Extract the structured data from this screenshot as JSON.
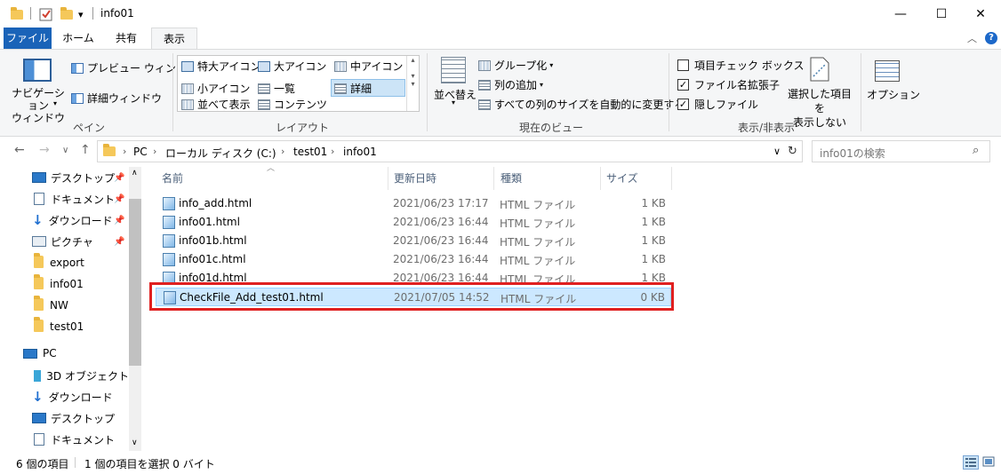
{
  "window": {
    "title": "info01",
    "minimize": "—",
    "maximize": "☐",
    "close": "✕"
  },
  "quick_access": {
    "properties_icon": "checkbox-icon",
    "dropdown": "▾"
  },
  "tabs": [
    "ファイル",
    "ホーム",
    "共有",
    "表示"
  ],
  "ribbon": {
    "pane": {
      "nav_pane": "ナビゲーション\nウィンドウ",
      "preview": "プレビュー ウィンドウ",
      "details": "詳細ウィンドウ",
      "label": "ペイン"
    },
    "layout": {
      "items": [
        "特大アイコン",
        "大アイコン",
        "中アイコン",
        "小アイコン",
        "一覧",
        "詳細",
        "並べて表示",
        "コンテンツ"
      ],
      "selected": "詳細",
      "label": "レイアウト"
    },
    "current_view": {
      "sort": "並べ替え",
      "group": "グループ化",
      "add_column": "列の追加",
      "autosize": "すべての列のサイズを自動的に変更する",
      "label": "現在のビュー"
    },
    "show_hide": {
      "item_checkbox": "項目チェック ボックス",
      "extensions": "ファイル名拡張子",
      "hidden": "隠しファイル",
      "hide_selected": "選択した項目を\n表示しない",
      "label": "表示/非表示",
      "checked": {
        "item_checkbox": false,
        "extensions": true,
        "hidden": true
      }
    },
    "options": "オプション"
  },
  "address": {
    "crumbs": [
      "PC",
      "ローカル ディスク (C:)",
      "test01",
      "info01"
    ],
    "search_placeholder": "info01の検索"
  },
  "nav_pane": {
    "items": [
      {
        "label": "デスクトップ",
        "icon": "desktop-icon",
        "pinned": true
      },
      {
        "label": "ドキュメント",
        "icon": "document-icon",
        "pinned": true
      },
      {
        "label": "ダウンロード",
        "icon": "download-icon",
        "pinned": true
      },
      {
        "label": "ピクチャ",
        "icon": "pictures-icon",
        "pinned": true
      },
      {
        "label": "export",
        "icon": "folder-icon",
        "pinned": false
      },
      {
        "label": "info01",
        "icon": "folder-icon",
        "pinned": false
      },
      {
        "label": "NW",
        "icon": "folder-icon",
        "pinned": false
      },
      {
        "label": "test01",
        "icon": "folder-icon",
        "pinned": false
      },
      {
        "label": "PC",
        "icon": "pc-icon",
        "pinned": false
      },
      {
        "label": "3D オブジェクト",
        "icon": "3d-objects-icon",
        "pinned": false
      },
      {
        "label": "ダウンロード",
        "icon": "download-icon",
        "pinned": false
      },
      {
        "label": "デスクトップ",
        "icon": "desktop-icon",
        "pinned": false
      },
      {
        "label": "ドキュメント",
        "icon": "document-icon",
        "pinned": false
      }
    ]
  },
  "columns": [
    "名前",
    "更新日時",
    "種類",
    "サイズ"
  ],
  "files": [
    {
      "name": "info_add.html",
      "modified": "2021/06/23 17:17",
      "type": "HTML ファイル",
      "size": "1 KB"
    },
    {
      "name": "info01.html",
      "modified": "2021/06/23 16:44",
      "type": "HTML ファイル",
      "size": "1 KB"
    },
    {
      "name": "info01b.html",
      "modified": "2021/06/23 16:44",
      "type": "HTML ファイル",
      "size": "1 KB"
    },
    {
      "name": "info01c.html",
      "modified": "2021/06/23 16:44",
      "type": "HTML ファイル",
      "size": "1 KB"
    },
    {
      "name": "info01d.html",
      "modified": "2021/06/23 16:44",
      "type": "HTML ファイル",
      "size": "1 KB"
    },
    {
      "name": "CheckFile_Add_test01.html",
      "modified": "2021/07/05 14:52",
      "type": "HTML ファイル",
      "size": "0 KB"
    }
  ],
  "selected_file_index": 5,
  "status": {
    "count": "6 個の項目",
    "selection": "1 個の項目を選択 0 バイト"
  },
  "colors": {
    "file_tab": "#1a63b8",
    "selection": "#cce8ff",
    "highlight_box": "#e02020"
  }
}
